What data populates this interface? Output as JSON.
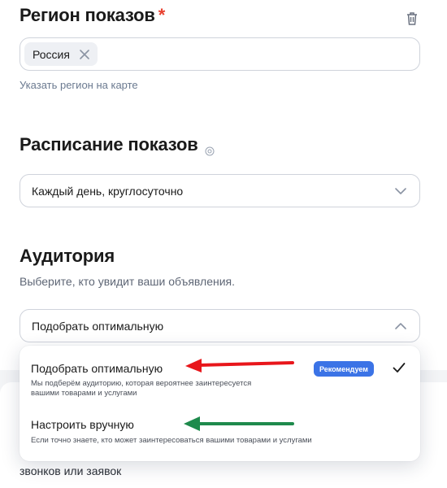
{
  "region": {
    "title": "Регион показов",
    "required_mark": "*",
    "chip_label": "Россия",
    "map_link": "Указать регион на карте"
  },
  "schedule": {
    "title": "Расписание показов",
    "selected": "Каждый день, круглосуточно"
  },
  "audience": {
    "title": "Аудитория",
    "subtitle": "Выберите, кто увидит ваши объявления.",
    "selected": "Подобрать оптимальную",
    "options": [
      {
        "title": "Подобрать оптимальную",
        "description_line1": "Мы подберём аудиторию, которая вероятнее заинтересуется",
        "description_line2": "вашими товарами и услугами",
        "badge": "Рекомендуем",
        "selected": true
      },
      {
        "title": "Настроить вручную",
        "description_line1": "Если точно знаете, кто может заинтересоваться вашими товарами и услугами"
      }
    ]
  },
  "background": {
    "text": "звонков или заявок"
  },
  "colors": {
    "accent": "#3b73e6",
    "required": "#e8402f",
    "red_arrow": "#e8161b",
    "green_arrow": "#1e8a4c"
  }
}
